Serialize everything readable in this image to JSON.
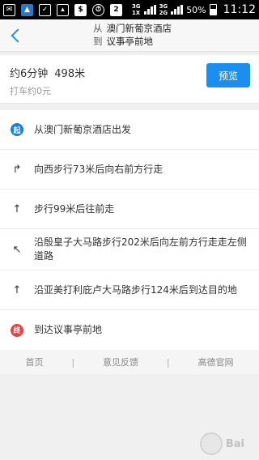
{
  "status_bar": {
    "icons": [
      "notification-icon",
      "photo-icon",
      "checkbox-icon",
      "image-icon",
      "dollar-icon",
      "alarm-icon",
      "sim-2-icon"
    ],
    "network_top": "3G",
    "network_bottom": "1X",
    "network2_top": "3G",
    "network2_bottom": "2G",
    "battery": "50%",
    "time": "11:12"
  },
  "header": {
    "from_label": "从",
    "from_place": "澳门新葡京酒店",
    "to_label": "到",
    "to_place": "议事亭前地"
  },
  "summary": {
    "duration": "约6分钟",
    "distance": "498米",
    "taxi": "打车约0元",
    "preview_label": "预览"
  },
  "steps": [
    {
      "icon": "start-icon",
      "badge": "起",
      "text": "从澳门新葡京酒店出发"
    },
    {
      "icon": "turn-right-front-icon",
      "text": "向西步行73米后向右前方行走"
    },
    {
      "icon": "straight-arrow-icon",
      "text": "步行99米后往前走"
    },
    {
      "icon": "turn-left-front-icon",
      "text": "沿殷皇子大马路步行202米后向左前方行走走左侧道路"
    },
    {
      "icon": "straight-arrow-icon",
      "text": "沿亚美打利庇卢大马路步行124米后到达目的地"
    },
    {
      "icon": "end-icon",
      "badge": "终",
      "text": "到达议事亭前地"
    }
  ],
  "footer": {
    "links": [
      "首页",
      "意见反馈",
      "高德官网"
    ],
    "separator": "|"
  },
  "watermark": "Bai"
}
